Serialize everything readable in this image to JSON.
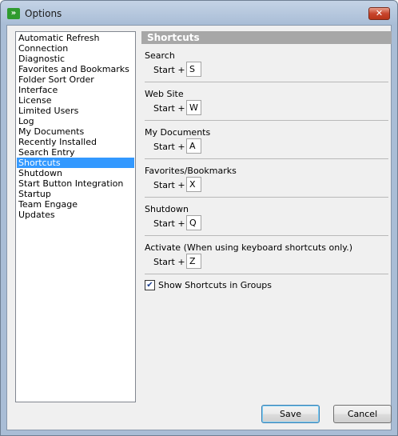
{
  "window": {
    "title": "Options"
  },
  "icons": {
    "app": "app-chevrons-icon",
    "close": "close-icon",
    "check": "checkmark-icon"
  },
  "sidebar": {
    "items": [
      {
        "label": "Automatic Refresh"
      },
      {
        "label": "Connection"
      },
      {
        "label": "Diagnostic"
      },
      {
        "label": "Favorites and Bookmarks"
      },
      {
        "label": "Folder Sort Order"
      },
      {
        "label": "Interface"
      },
      {
        "label": "License"
      },
      {
        "label": "Limited Users"
      },
      {
        "label": "Log"
      },
      {
        "label": "My Documents"
      },
      {
        "label": "Recently Installed"
      },
      {
        "label": "Search Entry"
      },
      {
        "label": "Shortcuts",
        "selected": true
      },
      {
        "label": "Shutdown"
      },
      {
        "label": "Start Button Integration"
      },
      {
        "label": "Startup"
      },
      {
        "label": "Team Engage"
      },
      {
        "label": "Updates"
      }
    ]
  },
  "panel": {
    "title": "Shortcuts",
    "shortcuts": [
      {
        "label": "Search",
        "prefix": "Start +",
        "key": "S"
      },
      {
        "label": "Web Site",
        "prefix": "Start +",
        "key": "W"
      },
      {
        "label": "My Documents",
        "prefix": "Start +",
        "key": "A"
      },
      {
        "label": "Favorites/Bookmarks",
        "prefix": "Start +",
        "key": "X"
      },
      {
        "label": "Shutdown",
        "prefix": "Start +",
        "key": "Q"
      },
      {
        "label": "Activate (When using keyboard shortcuts only.)",
        "prefix": "Start +",
        "key": "Z"
      }
    ],
    "show_groups": {
      "label": "Show Shortcuts in Groups",
      "checked": true
    }
  },
  "buttons": {
    "save": "Save",
    "cancel": "Cancel"
  },
  "colors": {
    "selection": "#3399ff",
    "header": "#a7a7a7"
  }
}
